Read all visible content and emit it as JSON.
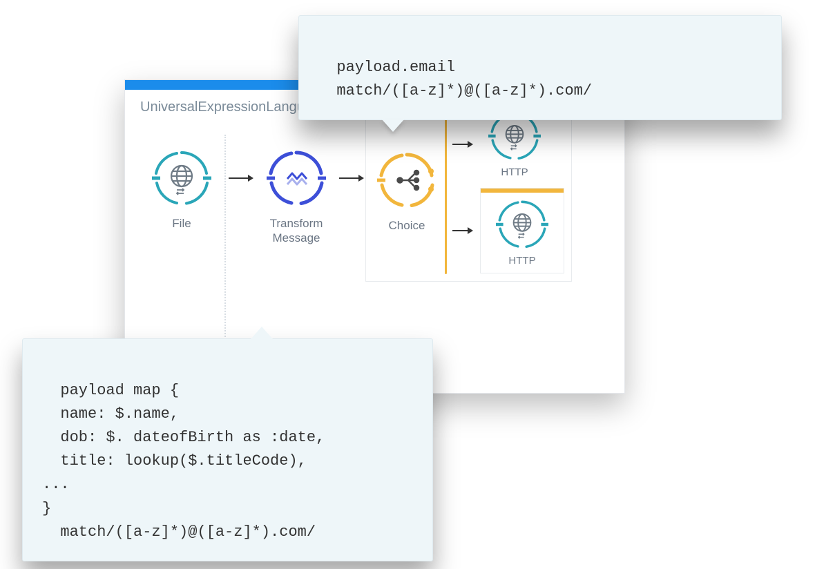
{
  "panel": {
    "title": "UniversalExpressionLanguage"
  },
  "nodes": {
    "file": {
      "label": "File"
    },
    "transform": {
      "label": "Transform\nMessage"
    },
    "choice": {
      "label": "Choice"
    },
    "http1": {
      "label": "HTTP"
    },
    "http2": {
      "label": "HTTP"
    }
  },
  "tooltips": {
    "top": "payload.email\n  match/([a-z]*)@([a-z]*).com/",
    "bottom": "payload map {\n  name: $.name,\n  dob: $. dateofBirth as :date,\n  title: lookup($.titleCode),\n...\n}\n  match/([a-z]*)@([a-z]*).com/"
  },
  "colors": {
    "headerBar": "#1b8ceb",
    "teal": "#2aa6b8",
    "indigo": "#3d4fd8",
    "amber": "#f2b63c",
    "grayText": "#6b7684"
  }
}
